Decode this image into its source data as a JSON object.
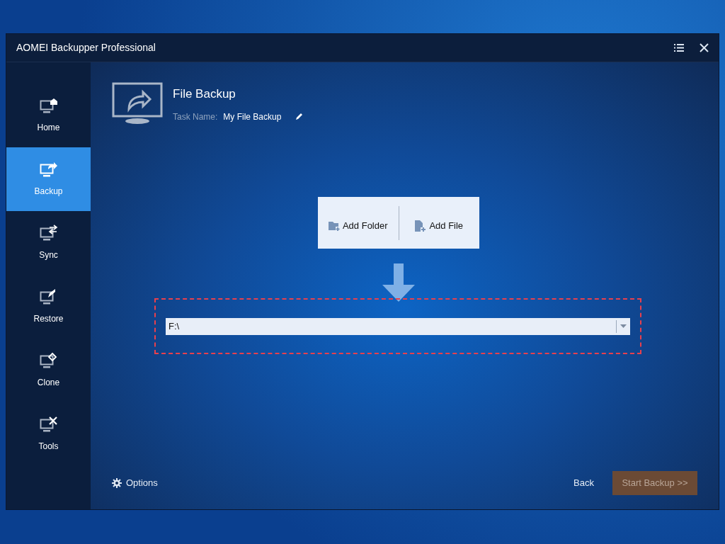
{
  "window": {
    "title": "AOMEI Backupper Professional"
  },
  "sidebar": {
    "items": [
      {
        "label": "Home",
        "selected": false
      },
      {
        "label": "Backup",
        "selected": true
      },
      {
        "label": "Sync",
        "selected": false
      },
      {
        "label": "Restore",
        "selected": false
      },
      {
        "label": "Clone",
        "selected": false
      },
      {
        "label": "Tools",
        "selected": false
      }
    ]
  },
  "header": {
    "title": "File Backup",
    "task_name_label": "Task Name:",
    "task_name": "My File Backup"
  },
  "add_buttons": [
    "Add Folder",
    "Add File"
  ],
  "source_field": {
    "value": "F:\\"
  },
  "footer": {
    "options": "Options",
    "back": "Back",
    "start": {
      "label": "Start Backup >>",
      "disabled": true
    }
  }
}
